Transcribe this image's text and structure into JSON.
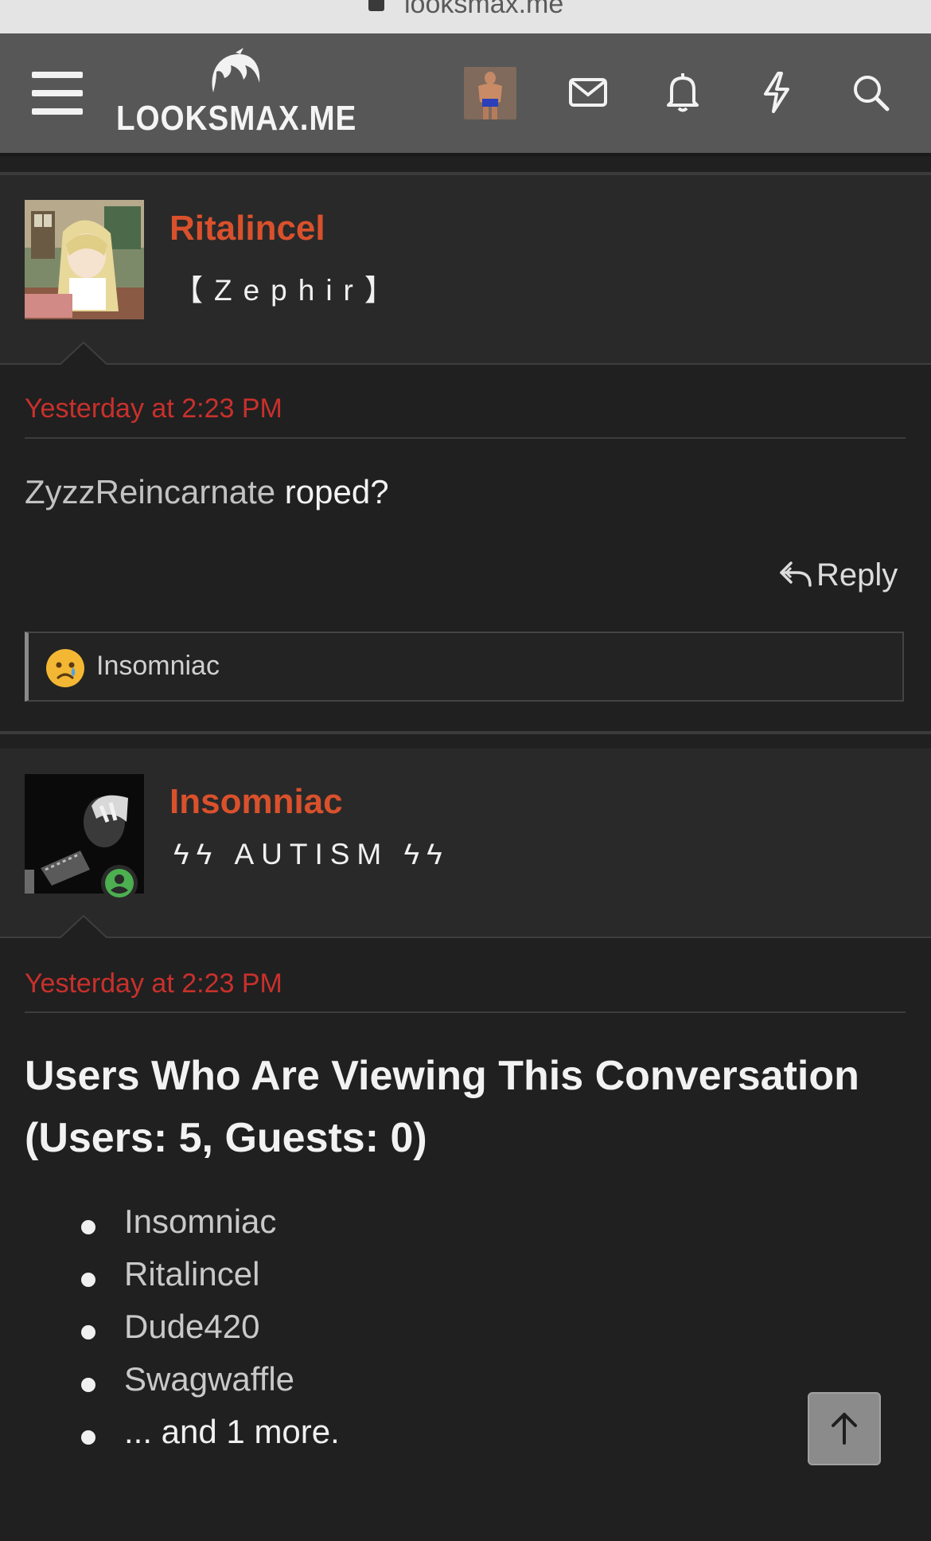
{
  "browser": {
    "url": "looksmax.me"
  },
  "header": {
    "logo_text": "LOOKSMAX.ME"
  },
  "posts": [
    {
      "username": "Ritalincel",
      "user_title": "【Zephir】",
      "timestamp": "Yesterday at 2:23 PM",
      "message_mention": "ZyzzReincarnate",
      "message_text": " roped?",
      "reply_label": "Reply",
      "reaction_user": "Insomniac"
    },
    {
      "username": "Insomniac",
      "user_title": "ϟϟ AUTISM ϟϟ",
      "timestamp": "Yesterday at 2:23 PM",
      "online": true
    }
  ],
  "viewers": {
    "title": "Users Who Are Viewing This Conversation (Users: 5, Guests: 0)",
    "users": [
      "Insomniac",
      "Ritalincel",
      "Dude420",
      "Swagwaffle"
    ],
    "more": "... and 1 more."
  },
  "colors": {
    "username": "#d9512c",
    "timestamp": "#c9302c",
    "background": "#202020",
    "header": "#575757"
  }
}
